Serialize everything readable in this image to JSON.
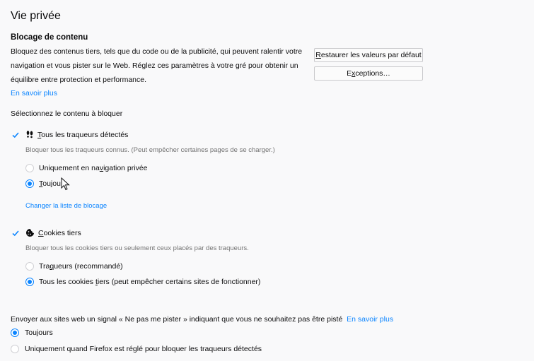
{
  "page_title": "Vie privée",
  "content_blocking": {
    "heading": "Blocage de contenu",
    "desc_line1": "Bloquez des contenus tiers, tels que du code ou de la publicité, qui peuvent ralentir votre",
    "desc_line2": "navigation et vous pister sur le Web. Réglez ces paramètres à votre gré pour obtenir un",
    "desc_line3": "équilibre entre protection et performance.",
    "learn_more": "En savoir plus",
    "restore_defaults_first": "R",
    "restore_defaults_rest": "estaurer les valeurs par défaut",
    "exceptions_prefix": "E",
    "exceptions_ul": "x",
    "exceptions_rest": "ceptions…",
    "select_label": "Sélectionnez le contenu à bloquer"
  },
  "trackers": {
    "checked": true,
    "label_ul": "T",
    "label_rest": "ous les traqueurs détectés",
    "desc": "Bloquer tous les traqueurs connus. (Peut empêcher certaines pages de se charger.)",
    "option_private_prefix": "Uniquement en na",
    "option_private_ul": "v",
    "option_private_rest": "igation privée",
    "option_always_ul": "T",
    "option_always_rest": "oujou",
    "change_list": "Changer la liste de blocage"
  },
  "cookies": {
    "checked": true,
    "label_ul": "C",
    "label_rest": "ookies tiers",
    "desc": "Bloquer tous les cookies tiers ou seulement ceux placés par des traqueurs.",
    "option_trackers_prefix": "Tra",
    "option_trackers_ul": "q",
    "option_trackers_rest": "ueurs (recommandé)",
    "option_all_prefix": "Tous les cookies ",
    "option_all_ul": "t",
    "option_all_rest": "iers (peut empêcher certains sites de fonctionner)"
  },
  "dnt": {
    "label": "Envoyer aux sites web un signal « Ne pas me pister » indiquant que vous ne souhaitez pas être pisté",
    "learn_more": "En savoir plus",
    "option_always": "Toujours",
    "option_only": "Uniquement quand Firefox est réglé pour bloquer les traqueurs détectés"
  },
  "colors": {
    "accent": "#0a84ff",
    "text": "#0c0c0d",
    "muted": "#737373",
    "background": "#f9f9fa"
  }
}
